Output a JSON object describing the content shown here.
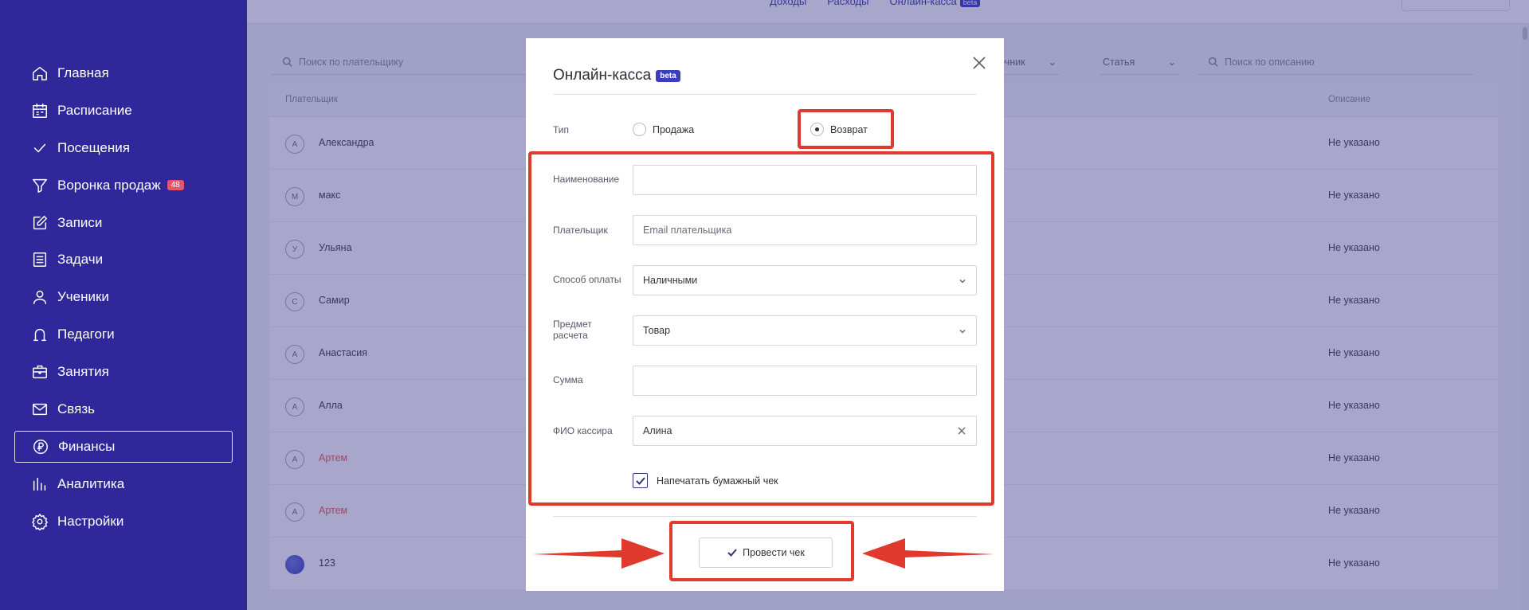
{
  "sidebar": {
    "items": [
      {
        "label": "Главная",
        "icon": "home-icon"
      },
      {
        "label": "Расписание",
        "icon": "calendar-icon"
      },
      {
        "label": "Посещения",
        "icon": "check-icon"
      },
      {
        "label": "Воронка продаж",
        "icon": "funnel-icon",
        "badge": "48"
      },
      {
        "label": "Записи",
        "icon": "edit-icon"
      },
      {
        "label": "Задачи",
        "icon": "tasks-icon"
      },
      {
        "label": "Ученики",
        "icon": "user-icon"
      },
      {
        "label": "Педагоги",
        "icon": "teacher-icon"
      },
      {
        "label": "Занятия",
        "icon": "briefcase-icon"
      },
      {
        "label": "Связь",
        "icon": "mail-icon"
      },
      {
        "label": "Финансы",
        "icon": "ruble-icon",
        "active": true
      },
      {
        "label": "Аналитика",
        "icon": "chart-icon"
      },
      {
        "label": "Настройки",
        "icon": "gear-icon"
      }
    ]
  },
  "topbar": {
    "tabs": [
      "Доходы",
      "Расходы",
      "Онлайн-касса"
    ],
    "beta": "beta"
  },
  "filters": {
    "payer_search_placeholder": "Поиск по плательщику",
    "source_label": "очник",
    "article_label": "Статья",
    "desc_search_placeholder": "Поиск по описанию"
  },
  "table": {
    "headers": {
      "payer": "Плательщик",
      "description": "Описание"
    },
    "rows": [
      {
        "initial": "А",
        "name": "Александра",
        "desc": "Не указано"
      },
      {
        "initial": "М",
        "name": "макс",
        "desc": "Не указано"
      },
      {
        "initial": "У",
        "name": "Ульяна",
        "desc": "Не указано"
      },
      {
        "initial": "С",
        "name": "Самир",
        "desc": "Не указано"
      },
      {
        "initial": "А",
        "name": "Анастасия",
        "desc": "Не указано"
      },
      {
        "initial": "А",
        "name": "Алла",
        "desc": "Не указано"
      },
      {
        "initial": "А",
        "name": "Артем",
        "desc": "Не указано",
        "red": true
      },
      {
        "initial": "А",
        "name": "Артем",
        "desc": "Не указано",
        "red": true
      },
      {
        "initial": "",
        "name": "123",
        "desc": "Не указано",
        "image": true
      }
    ]
  },
  "modal": {
    "title": "Онлайн-касса",
    "beta": "beta",
    "type_label": "Тип",
    "type_options": [
      "Продажа",
      "Возврат"
    ],
    "type_selected": "Возврат",
    "name_label": "Наименование",
    "name_value": "",
    "payer_label": "Плательщик",
    "payer_placeholder": "Email плательщика",
    "payment_label": "Способ оплаты",
    "payment_value": "Наличными",
    "subject_label": "Предмет расчета",
    "subject_value": "Товар",
    "sum_label": "Сумма",
    "sum_value": "",
    "cashier_label": "ФИО кассира",
    "cashier_value": "Алина",
    "print_label": "Напечатать бумажный чек",
    "print_checked": true,
    "submit_label": "Провести чек"
  },
  "colors": {
    "sidebar": "#30289a",
    "accent": "#3b3fbf",
    "annotation": "#e03a2e",
    "red_text": "#e0614a"
  }
}
